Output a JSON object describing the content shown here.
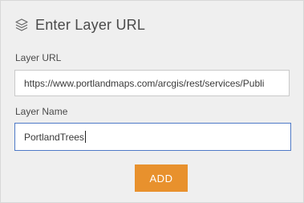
{
  "header": {
    "title": "Enter Layer URL",
    "icon": "layers-icon"
  },
  "fields": {
    "url_label": "Layer URL",
    "url_value": "https://www.portlandmaps.com/arcgis/rest/services/Publi",
    "name_label": "Layer Name",
    "name_value": "PortlandTrees"
  },
  "actions": {
    "add_label": "ADD"
  },
  "colors": {
    "panel_bg": "#efefef",
    "add_button_bg": "#e8912d",
    "focus_border": "#4f7ac7"
  }
}
